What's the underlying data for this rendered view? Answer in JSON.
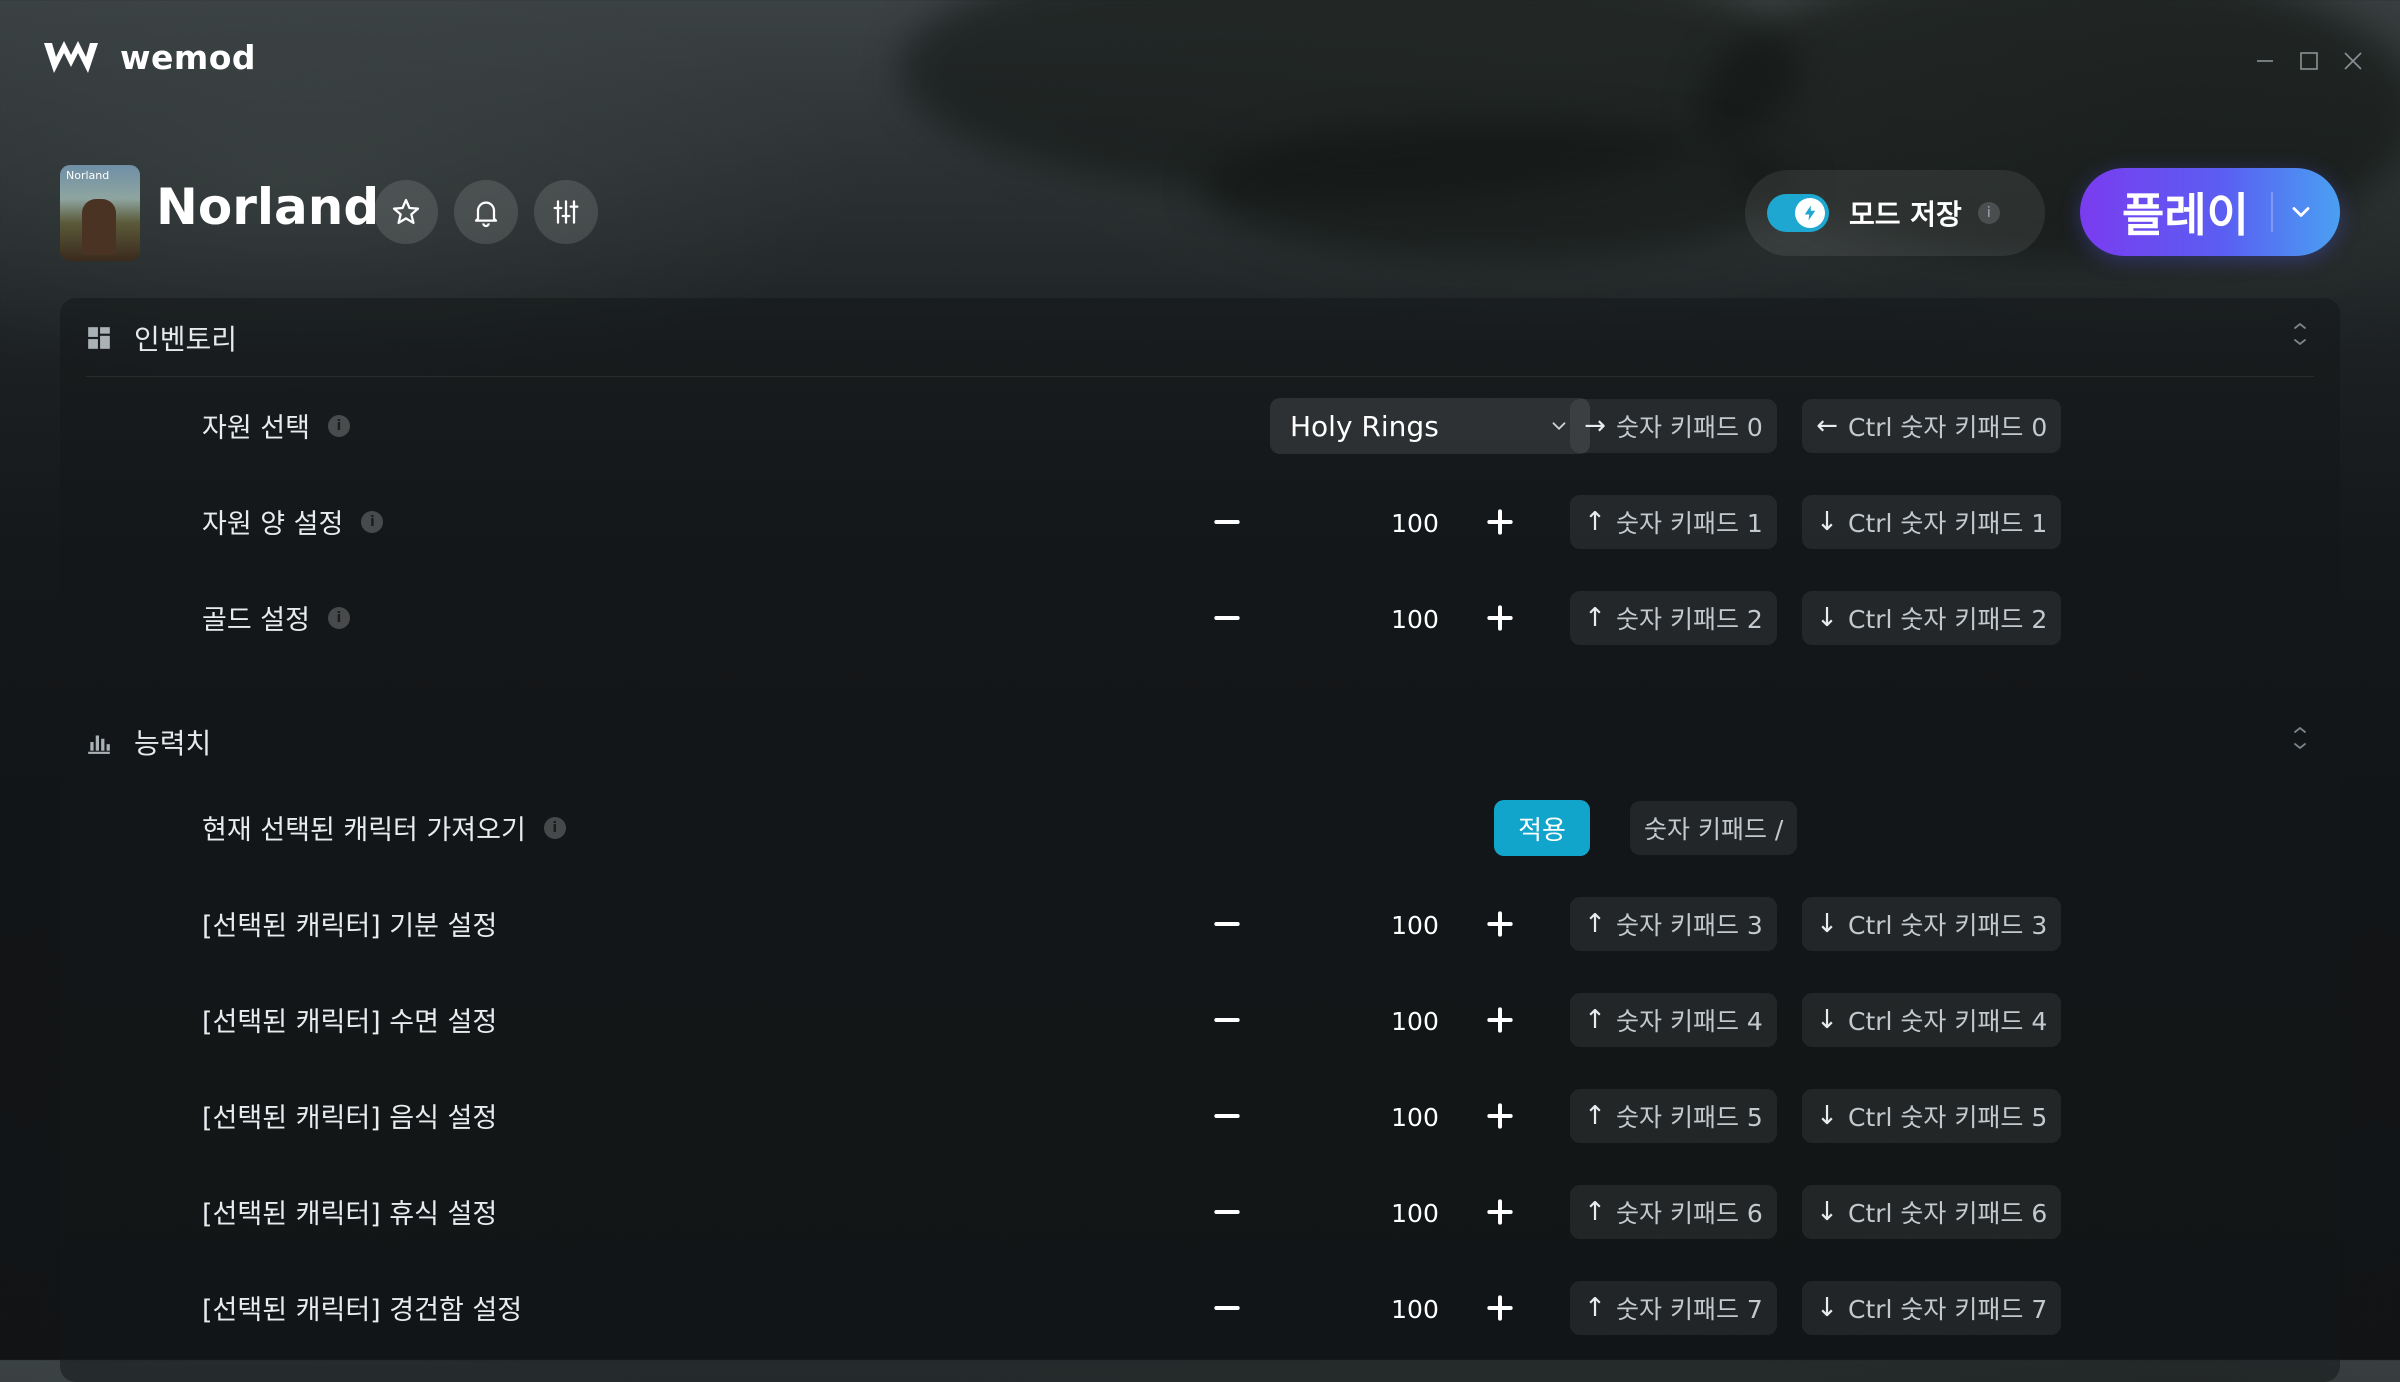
{
  "app": {
    "name": "wemod"
  },
  "window_controls": {
    "minimize": "minimize-icon",
    "maximize": "maximize-icon",
    "close": "close-icon"
  },
  "game": {
    "title": "Norland",
    "thumb_caption": "Norland"
  },
  "header": {
    "mod_save_label": "모드 저장",
    "mod_save_info": "i",
    "mod_save_enabled": true,
    "play_label": "플레이"
  },
  "colors": {
    "accent": "#12a5cc",
    "play_gradient_start": "#7a3cf0",
    "play_gradient_end": "#4aa0f2"
  },
  "sections": [
    {
      "title": "인벤토리",
      "icon": "inventory-grid-icon",
      "rows": [
        {
          "label": "자원 선택",
          "type": "select",
          "value": "Holy Rings",
          "hk1_arrow": "→",
          "hk1": "숫자 키패드 0",
          "hk2_arrow": "←",
          "hk2": "Ctrl 숫자 키패드 0"
        },
        {
          "label": "자원 양 설정",
          "type": "stepper",
          "value": "100",
          "hk1_arrow": "↑",
          "hk1": "숫자 키패드 1",
          "hk2_arrow": "↓",
          "hk2": "Ctrl 숫자 키패드 1"
        },
        {
          "label": "골드 설정",
          "type": "stepper",
          "value": "100",
          "hk1_arrow": "↑",
          "hk1": "숫자 키패드 2",
          "hk2_arrow": "↓",
          "hk2": "Ctrl 숫자 키패드 2"
        }
      ]
    },
    {
      "title": "능력치",
      "icon": "bar-chart-icon",
      "rows": [
        {
          "label": "현재 선택된 캐릭터 가져오기",
          "type": "button",
          "button": "적용",
          "hk1": "숫자 키패드 /"
        },
        {
          "label": "[선택된 캐릭터] 기분 설정",
          "type": "stepper",
          "value": "100",
          "hk1_arrow": "↑",
          "hk1": "숫자 키패드 3",
          "hk2_arrow": "↓",
          "hk2": "Ctrl 숫자 키패드 3"
        },
        {
          "label": "[선택된 캐릭터] 수면 설정",
          "type": "stepper",
          "value": "100",
          "hk1_arrow": "↑",
          "hk1": "숫자 키패드 4",
          "hk2_arrow": "↓",
          "hk2": "Ctrl 숫자 키패드 4"
        },
        {
          "label": "[선택된 캐릭터] 음식 설정",
          "type": "stepper",
          "value": "100",
          "hk1_arrow": "↑",
          "hk1": "숫자 키패드 5",
          "hk2_arrow": "↓",
          "hk2": "Ctrl 숫자 키패드 5"
        },
        {
          "label": "[선택된 캐릭터] 휴식 설정",
          "type": "stepper",
          "value": "100",
          "hk1_arrow": "↑",
          "hk1": "숫자 키패드 6",
          "hk2_arrow": "↓",
          "hk2": "Ctrl 숫자 키패드 6"
        },
        {
          "label": "[선택된 캐릭터] 경건함 설정",
          "type": "stepper",
          "value": "100",
          "hk1_arrow": "↑",
          "hk1": "숫자 키패드 7",
          "hk2_arrow": "↓",
          "hk2": "Ctrl 숫자 키패드 7"
        }
      ]
    }
  ]
}
